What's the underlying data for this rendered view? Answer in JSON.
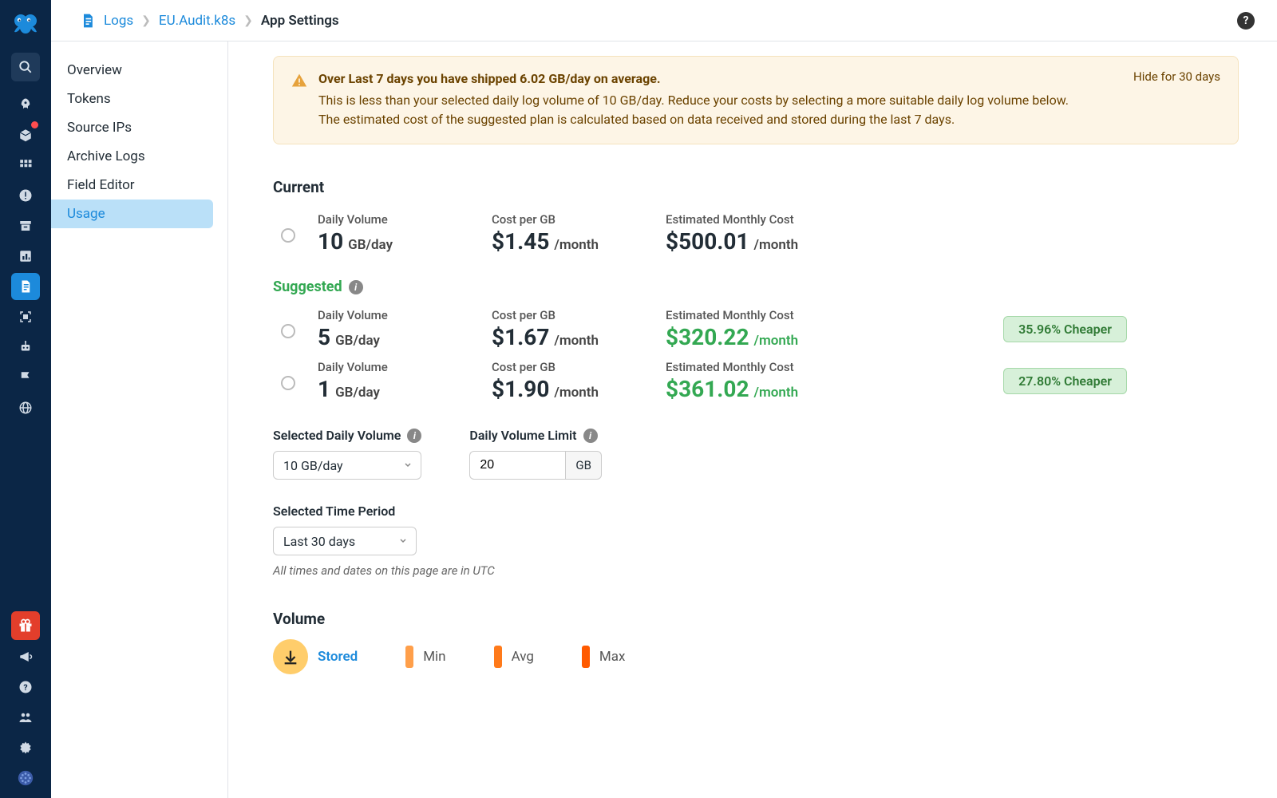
{
  "breadcrumb": {
    "root": "Logs",
    "middle": "EU.Audit.k8s",
    "current": "App Settings"
  },
  "sidebar": {
    "items": [
      {
        "label": "Overview"
      },
      {
        "label": "Tokens"
      },
      {
        "label": "Source IPs"
      },
      {
        "label": "Archive Logs"
      },
      {
        "label": "Field Editor"
      },
      {
        "label": "Usage"
      }
    ]
  },
  "alert": {
    "title": "Over Last 7 days you have shipped 6.02 GB/day on average.",
    "body1": "This is less than your selected daily log volume of 10 GB/day. Reduce your costs by selecting a more suitable daily log volume below.",
    "body2": "The estimated cost of the suggested plan is calculated based on data received and stored during the last 7 days.",
    "hide": "Hide for 30 days"
  },
  "sections": {
    "current": "Current",
    "suggested": "Suggested",
    "volume": "Volume"
  },
  "labels": {
    "daily_volume": "Daily Volume",
    "cost_per_gb": "Cost per GB",
    "est_monthly": "Estimated Monthly Cost",
    "sel_daily": "Selected Daily Volume",
    "daily_limit": "Daily Volume Limit",
    "sel_period": "Selected Time Period",
    "utc_note": "All times and dates on this page are in UTC",
    "per_month": "/month",
    "gb_day": "GB/day",
    "gb": "GB"
  },
  "plans": {
    "current": {
      "vol": "10",
      "cost": "$1.45",
      "monthly": "$500.01"
    },
    "suggested": [
      {
        "vol": "5",
        "cost": "$1.67",
        "monthly": "$320.22",
        "cheaper": "35.96% Cheaper"
      },
      {
        "vol": "1",
        "cost": "$1.90",
        "monthly": "$361.02",
        "cheaper": "27.80% Cheaper"
      }
    ]
  },
  "controls": {
    "sel_daily_value": "10 GB/day",
    "daily_limit_value": "20",
    "sel_period_value": "Last 30 days"
  },
  "volume_legend": {
    "stored": "Stored",
    "min": "Min",
    "avg": "Avg",
    "max": "Max"
  }
}
